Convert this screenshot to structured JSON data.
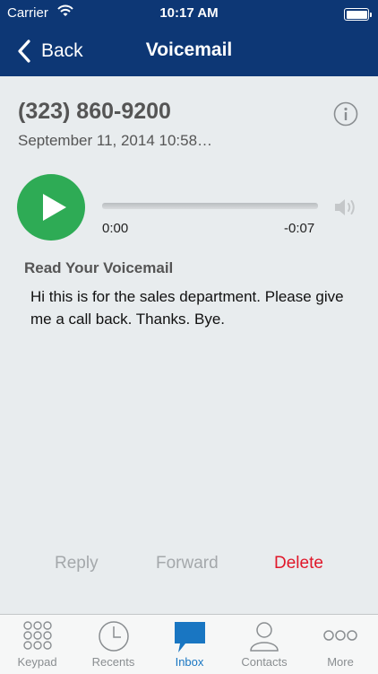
{
  "status_bar": {
    "carrier": "Carrier",
    "time": "10:17 AM"
  },
  "nav": {
    "back_label": "Back",
    "title": "Voicemail"
  },
  "voicemail": {
    "phone_number": "(323) 860-9200",
    "datetime": "September 11, 2014 10:58…",
    "elapsed": "0:00",
    "remaining": "-0:07",
    "progress": 0,
    "read_title": "Read Your Voicemail",
    "transcript": "Hi this is for the sales department. Please give me a call back. Thanks. Bye."
  },
  "actions": {
    "reply": "Reply",
    "forward": "Forward",
    "delete": "Delete"
  },
  "tabs": [
    {
      "label": "Keypad",
      "icon": "keypad-icon"
    },
    {
      "label": "Recents",
      "icon": "clock-icon"
    },
    {
      "label": "Inbox",
      "icon": "inbox-icon",
      "active": true
    },
    {
      "label": "Contacts",
      "icon": "contact-icon"
    },
    {
      "label": "More",
      "icon": "more-icon"
    }
  ],
  "colors": {
    "navbar": "#0d3775",
    "play": "#2eab55",
    "delete": "#e0182a",
    "active_tab": "#1976c2",
    "background": "#e8ecee"
  }
}
